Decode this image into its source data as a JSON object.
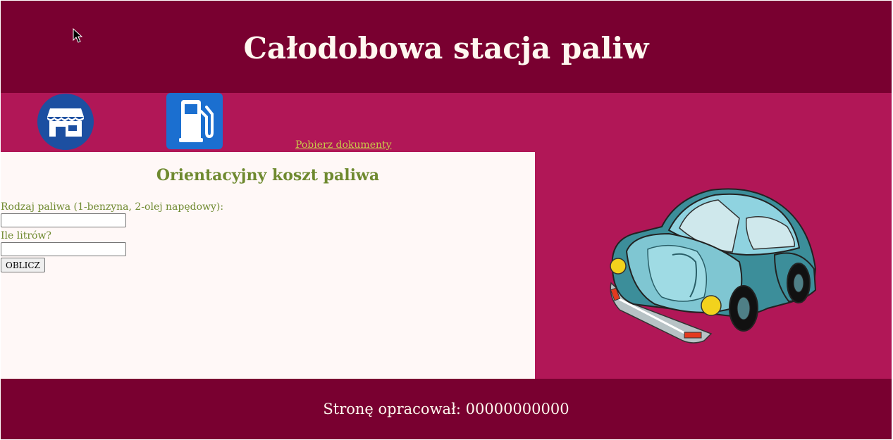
{
  "header": {
    "title": "Całodobowa stacja paliw"
  },
  "nav": {
    "items": [
      {
        "icon": "store-icon"
      },
      {
        "icon": "fuel-pump-icon"
      }
    ],
    "docs_link": "Pobierz dokumenty"
  },
  "calculator": {
    "title": "Orientacyjny koszt paliwa",
    "fuel_type_label": "Rodzaj paliwa (1-benzyna, 2-olej napędowy):",
    "fuel_type_value": "",
    "liters_label": "Ile litrów?",
    "liters_value": "",
    "button_label": "OBLICZ"
  },
  "image": {
    "icon": "car-illustration"
  },
  "footer": {
    "text": "Stronę opracował: 00000000000"
  },
  "colors": {
    "banner": "#790030",
    "nav_bg": "#b11757",
    "content_bg": "#fff8f7",
    "text_green": "#6f8a30",
    "link_yellow": "#c9c84a"
  }
}
